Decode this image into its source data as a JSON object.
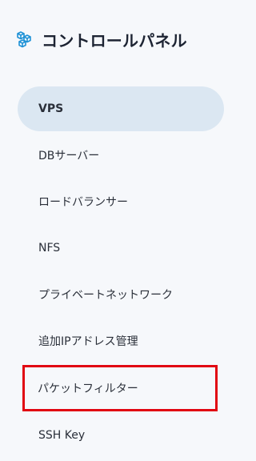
{
  "brand": {
    "title": "コントロールパネル",
    "icon": "cubes-icon",
    "accent": "#1e92d6"
  },
  "nav": {
    "items": [
      {
        "label": "VPS",
        "active": true
      },
      {
        "label": "DBサーバー"
      },
      {
        "label": "ロードバランサー"
      },
      {
        "label": "NFS"
      },
      {
        "label": "プライベートネットワーク"
      },
      {
        "label": "追加IPアドレス管理"
      },
      {
        "label": "パケットフィルター",
        "highlighted": true
      },
      {
        "label": "SSH Key"
      }
    ]
  },
  "colors": {
    "background": "#f6f8fb",
    "active_bg": "#dbe7f2",
    "highlight_border": "#e10612"
  }
}
